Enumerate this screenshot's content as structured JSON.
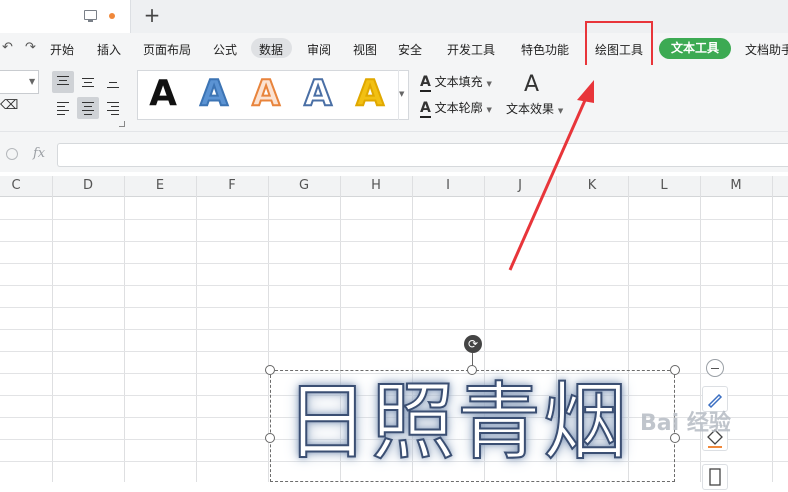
{
  "titlebar": {
    "plus_symbol": "+"
  },
  "menu": {
    "items": [
      "开始",
      "插入",
      "页面布局",
      "公式",
      "数据",
      "审阅",
      "视图",
      "安全",
      "开发工具",
      "特色功能",
      "绘图工具",
      "文本工具",
      "文档助手"
    ],
    "active_item": "数据",
    "contextual_item": "文本工具",
    "highlighted_item": "绘图工具",
    "accent_color": "#3caa53",
    "highlight_color": "#e8353a"
  },
  "toolbar": {
    "art_styles": [
      {
        "letter": "A",
        "fill": "#111111",
        "outline": "#111111"
      },
      {
        "letter": "A",
        "fill": "#5b93d3",
        "outline": "#3c74b4"
      },
      {
        "letter": "A",
        "fill": "#fbe2d2",
        "outline": "#e8843c"
      },
      {
        "letter": "A",
        "fill": "#ffffff",
        "outline": "#4a6fa5"
      },
      {
        "letter": "A",
        "fill": "#f2c013",
        "outline": "#e0a800"
      }
    ],
    "text_fill": "文本填充",
    "text_outline": "文本轮廓",
    "text_effect": "文本效果"
  },
  "formula_bar": {
    "fx_label": "fx",
    "value": ""
  },
  "sheet": {
    "columns": [
      "C",
      "D",
      "E",
      "F",
      "G",
      "H",
      "I",
      "J",
      "K",
      "L",
      "M"
    ]
  },
  "wordart": {
    "text": "日照青烟"
  },
  "watermark": {
    "text": "Bai 经验"
  },
  "icons": [
    "monitor-icon",
    "unsaved-dot-icon",
    "plus-icon",
    "undo-icon",
    "redo-icon",
    "eraser-icon",
    "align-top-icon",
    "align-middle-icon",
    "align-bottom-icon",
    "align-left-icon",
    "align-center-icon",
    "align-right-icon",
    "text-fill-icon",
    "text-outline-icon",
    "text-effect-icon",
    "zoom-icon",
    "rotate-icon",
    "minus-icon",
    "brush-icon",
    "shape-fill-icon",
    "shape-outline-icon"
  ]
}
